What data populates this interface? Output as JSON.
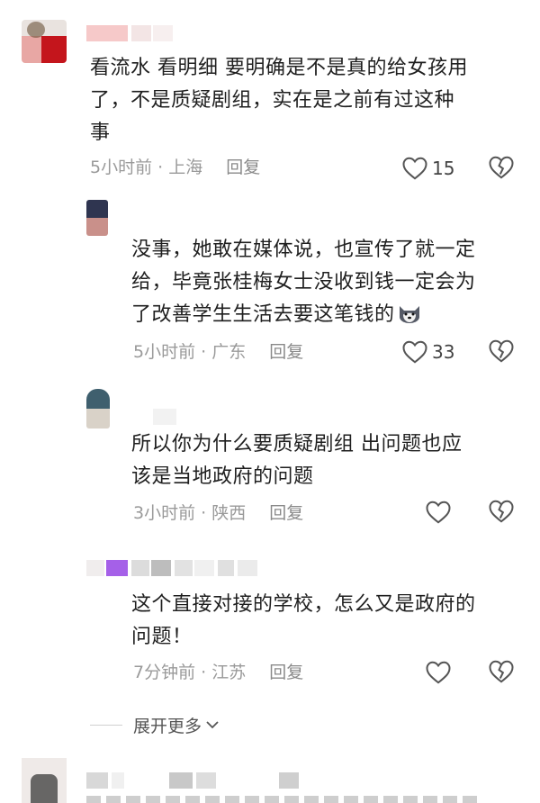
{
  "comments": [
    {
      "text_lines": [
        "看流水 看明细 要明确是不是真的给女孩用",
        "了，不是质疑剧组，实在是之前有过这种",
        "事"
      ],
      "time_loc": "5小时前 · 上海",
      "reply_label": "回复",
      "likes": "15"
    },
    {
      "text_lines": [
        "没事，她敢在媒体说，也宣传了就一定",
        "给，毕竟张桂梅女士没收到钱一定会为",
        "了改善学生生活去要这笔钱的"
      ],
      "emoji": "dog-emoji",
      "time_loc": "5小时前 · 广东",
      "reply_label": "回复",
      "likes": "33"
    },
    {
      "text_lines": [
        "所以你为什么要质疑剧组  出问题也应",
        "该是当地政府的问题"
      ],
      "time_loc": "3小时前 · 陕西",
      "reply_label": "回复",
      "likes": ""
    },
    {
      "text_lines": [
        "这个直接对接的学校，怎么又是政府的",
        "问题！"
      ],
      "time_loc": "7分钟前 · 江苏",
      "reply_label": "回复",
      "likes": ""
    }
  ],
  "expand_label": "展开更多",
  "colors": {
    "text": "#1f1f1f",
    "meta": "#9a9a9a",
    "icon": "#555555"
  }
}
